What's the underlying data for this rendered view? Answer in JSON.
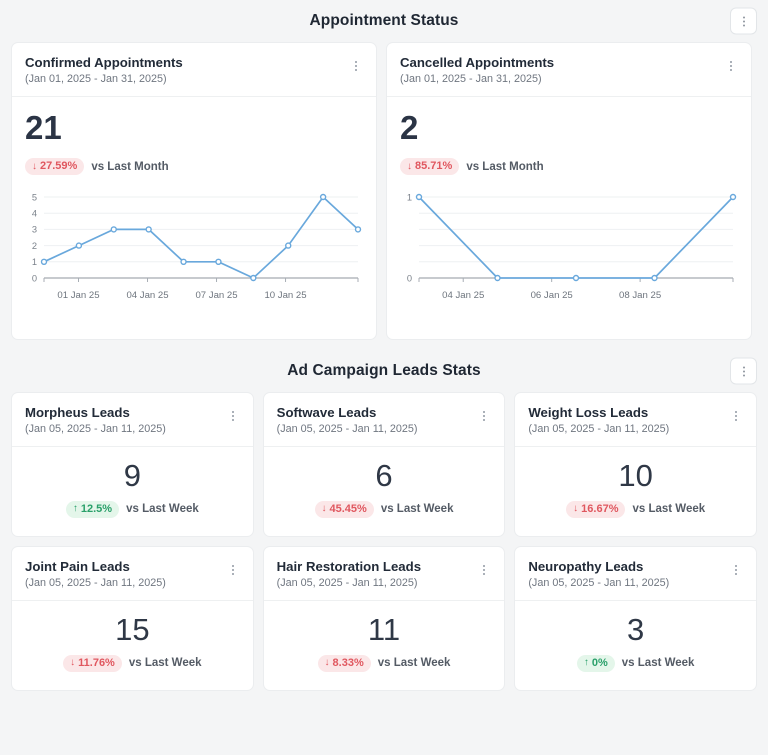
{
  "sections": [
    {
      "title": "Appointment Status",
      "menu_icon": "kebab-vertical-icon"
    },
    {
      "title": "Ad Campaign Leads Stats",
      "menu_icon": "kebab-vertical-icon"
    }
  ],
  "appointment_cards": [
    {
      "title": "Confirmed Appointments",
      "range": "(Jan 01, 2025 - Jan 31, 2025)",
      "value": "21",
      "delta": "27.59%",
      "delta_arrow": "↓",
      "delta_direction": "down",
      "delta_label": "vs Last Month"
    },
    {
      "title": "Cancelled Appointments",
      "range": "(Jan 01, 2025 - Jan 31, 2025)",
      "value": "2",
      "delta": "85.71%",
      "delta_arrow": "↓",
      "delta_direction": "down",
      "delta_label": "vs Last Month"
    }
  ],
  "lead_cards": [
    {
      "title": "Morpheus Leads",
      "range": "(Jan 05, 2025 - Jan 11, 2025)",
      "value": "9",
      "delta": "12.5%",
      "delta_arrow": "↑",
      "delta_direction": "up",
      "delta_label": "vs Last Week"
    },
    {
      "title": "Softwave Leads",
      "range": "(Jan 05, 2025 - Jan 11, 2025)",
      "value": "6",
      "delta": "45.45%",
      "delta_arrow": "↓",
      "delta_direction": "down",
      "delta_label": "vs Last Week"
    },
    {
      "title": "Weight Loss Leads",
      "range": "(Jan 05, 2025 - Jan 11, 2025)",
      "value": "10",
      "delta": "16.67%",
      "delta_arrow": "↓",
      "delta_direction": "down",
      "delta_label": "vs Last Week"
    },
    {
      "title": "Joint Pain Leads",
      "range": "(Jan 05, 2025 - Jan 11, 2025)",
      "value": "15",
      "delta": "11.76%",
      "delta_arrow": "↓",
      "delta_direction": "down",
      "delta_label": "vs Last Week"
    },
    {
      "title": "Hair Restoration Leads",
      "range": "(Jan 05, 2025 - Jan 11, 2025)",
      "value": "11",
      "delta": "8.33%",
      "delta_arrow": "↓",
      "delta_direction": "down",
      "delta_label": "vs Last Week"
    },
    {
      "title": "Neuropathy Leads",
      "range": "(Jan 05, 2025 - Jan 11, 2025)",
      "value": "3",
      "delta": "0%",
      "delta_arrow": "↑",
      "delta_direction": "up",
      "delta_label": "vs Last Week"
    }
  ],
  "colors": {
    "page_bg": "#f4f5f6",
    "card_bg": "#ffffff",
    "card_border": "#ebedef",
    "text_dark": "#2b3445",
    "text_muted": "#6f7680",
    "line_blue": "#69a8dc",
    "badge_down_bg": "#fbe7e8",
    "badge_down_text": "#e0575f",
    "badge_up_bg": "#e4f6ea",
    "badge_up_text": "#2aa06a",
    "gridline": "#eef0f2"
  },
  "chart_data": [
    {
      "type": "line",
      "title": "Confirmed Appointments",
      "xlabel": "",
      "ylabel": "",
      "x": [
        "01 Jan 25",
        "02 Jan 25",
        "03 Jan 25",
        "04 Jan 25",
        "05 Jan 25",
        "06 Jan 25",
        "07 Jan 25",
        "08 Jan 25",
        "09 Jan 25",
        "10 Jan 25"
      ],
      "values": [
        1,
        2,
        3,
        3,
        1,
        1,
        0,
        2,
        5,
        3
      ],
      "xtick_labels": [
        "01 Jan 25",
        "04 Jan 25",
        "07 Jan 25",
        "10 Jan 25"
      ],
      "ytick_labels": [
        "0",
        "1",
        "2",
        "3",
        "4",
        "5"
      ],
      "ylim": [
        0,
        5
      ],
      "grid": true,
      "legend": false,
      "series_color": "#69a8dc",
      "markers": true
    },
    {
      "type": "line",
      "title": "Cancelled Appointments",
      "xlabel": "",
      "ylabel": "",
      "x": [
        "04 Jan 25",
        "05 Jan 25",
        "06 Jan 25",
        "07 Jan 25",
        "08 Jan 25"
      ],
      "values": [
        1,
        0,
        0,
        0,
        1
      ],
      "xtick_labels": [
        "04 Jan 25",
        "06 Jan 25",
        "08 Jan 25"
      ],
      "ytick_labels": [
        "0",
        "1"
      ],
      "ylim": [
        0,
        1
      ],
      "grid": true,
      "legend": false,
      "series_color": "#69a8dc",
      "markers": true
    }
  ]
}
